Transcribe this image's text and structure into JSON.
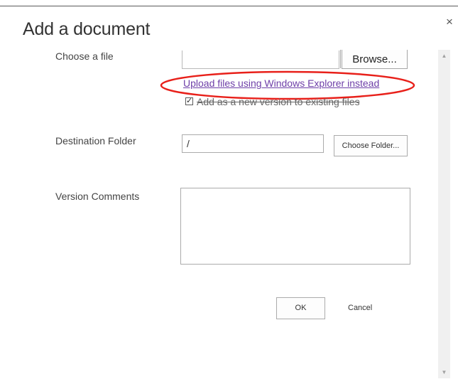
{
  "dialog": {
    "title": "Add a document",
    "close_glyph": "×"
  },
  "file": {
    "label": "Choose a file",
    "value": "",
    "browse_label": "Browse...",
    "upload_link": "Upload files using Windows Explorer instead",
    "version_checked": true,
    "version_label": "Add as a new version to existing files"
  },
  "destination": {
    "label": "Destination Folder",
    "value": "/",
    "choose_label": "Choose Folder..."
  },
  "comments": {
    "label": "Version Comments",
    "value": ""
  },
  "actions": {
    "ok_label": "OK",
    "cancel_label": "Cancel"
  },
  "scrollbar": {
    "up_glyph": "▲",
    "down_glyph": "▼"
  },
  "colors": {
    "link": "#6e3fa8",
    "annotation_ellipse": "#e8201a"
  }
}
